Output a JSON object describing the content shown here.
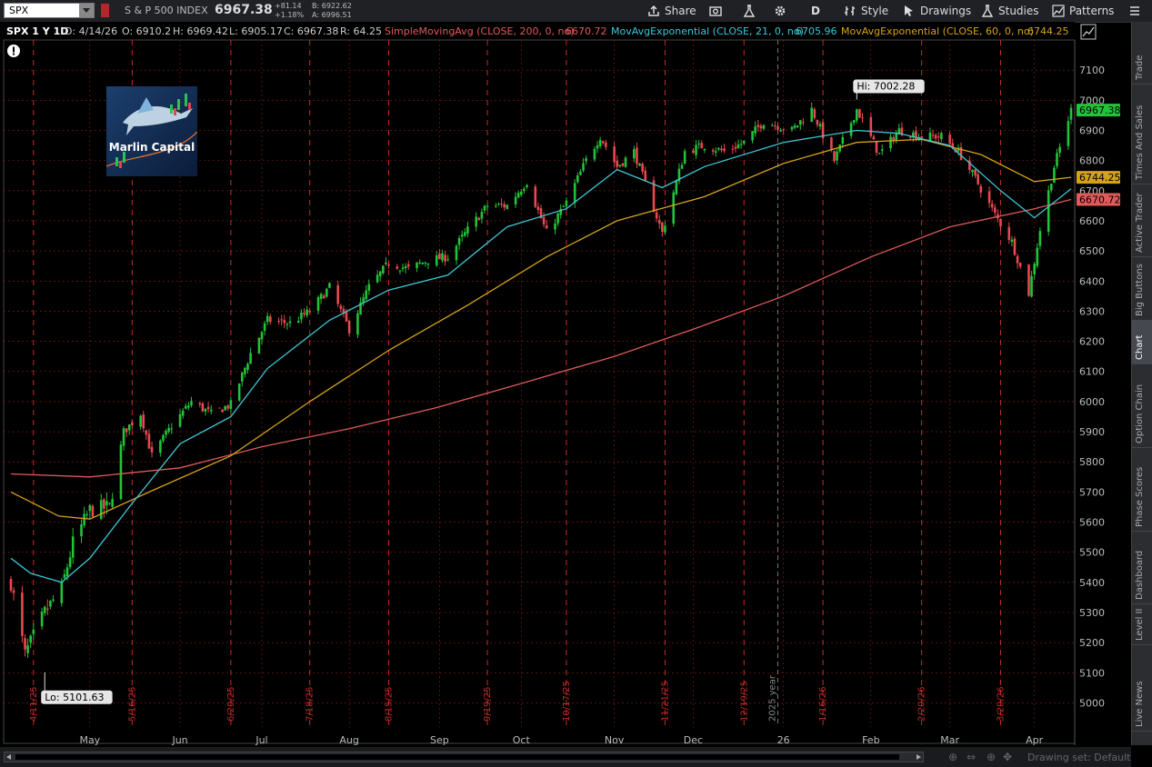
{
  "toolbar": {
    "symbol": "SPX",
    "index_name": "S & P 500 INDEX",
    "last_price": "6967.38",
    "change": "+81.14",
    "change_pct": "+1.18%",
    "bid": "B: 6922.62",
    "ask": "A: 6996.51",
    "buttons": {
      "share": "Share",
      "aggregation": "D",
      "style": "Style",
      "drawings": "Drawings",
      "studies": "Studies",
      "patterns": "Patterns"
    }
  },
  "study_bar": {
    "title": "SPX 1 Y 1D",
    "date": "D: 4/14/26",
    "open": "O: 6910.2",
    "high": "H: 6969.42",
    "low": "L: 6905.17",
    "close": "C: 6967.38",
    "range": "R: 64.25",
    "sma200_label": "SimpleMovingAvg (CLOSE, 200, 0, no)",
    "sma200_value": "6670.72",
    "ema21_label": "MovAvgExponential (CLOSE, 21, 0, no)",
    "ema21_value": "6705.96",
    "ema60_label": "MovAvgExponential (CLOSE, 60, 0, no)",
    "ema60_value": "6744.25"
  },
  "logo": {
    "text": "Marlin Capital"
  },
  "sidebar": [
    "Trade",
    "Times And Sales",
    "Active Trader",
    "Big Buttons",
    "Chart",
    "Option Chain",
    "Phase Scores",
    "Dashboard",
    "Level II",
    "Live News"
  ],
  "bottom": {
    "drawing_set": "Drawing set: Default"
  },
  "colors": {
    "up": "#22c33a",
    "down": "#e8484f",
    "ema21": "#3ec6d6",
    "ema60": "#d4a21a",
    "sma200": "#e05a5a",
    "grid": "#8b1a1a",
    "background": "#000000"
  },
  "chart_data": {
    "type": "candlestick",
    "ylim": [
      4920,
      7200
    ],
    "y_ticks": [
      5000,
      5100,
      5200,
      5300,
      5400,
      5500,
      5600,
      5700,
      5800,
      5900,
      6000,
      6100,
      6200,
      6300,
      6400,
      6500,
      6600,
      6700,
      6800,
      6900,
      7000,
      7100
    ],
    "months": [
      {
        "label": "May",
        "date": "2025-05-01"
      },
      {
        "label": "Jun",
        "date": "2025-06-02"
      },
      {
        "label": "Jul",
        "date": "2025-07-01"
      },
      {
        "label": "Aug",
        "date": "2025-08-01"
      },
      {
        "label": "Sep",
        "date": "2025-09-02"
      },
      {
        "label": "Oct",
        "date": "2025-10-01"
      },
      {
        "label": "Nov",
        "date": "2025-11-03"
      },
      {
        "label": "Dec",
        "date": "2025-12-01"
      },
      {
        "label": "26",
        "date": "2026-01-02"
      },
      {
        "label": "Feb",
        "date": "2026-02-02"
      },
      {
        "label": "Mar",
        "date": "2026-03-02"
      },
      {
        "label": "Apr",
        "date": "2026-04-01"
      }
    ],
    "events": [
      {
        "label": "4/11/25",
        "date": "2025-04-11"
      },
      {
        "label": "5/16/25",
        "date": "2025-05-16"
      },
      {
        "label": "6/20/25",
        "date": "2025-06-20"
      },
      {
        "label": "7/18/25",
        "date": "2025-07-18"
      },
      {
        "label": "8/15/25",
        "date": "2025-08-15"
      },
      {
        "label": "9/19/25",
        "date": "2025-09-19"
      },
      {
        "label": "10/17/25",
        "date": "2025-10-17"
      },
      {
        "label": "11/21/25",
        "date": "2025-11-21"
      },
      {
        "label": "12/19/25",
        "date": "2025-12-19"
      },
      {
        "label": "1/16/26",
        "date": "2026-01-16"
      },
      {
        "label": "2/20/26",
        "date": "2026-02-20"
      },
      {
        "label": "3/20/26",
        "date": "2026-03-20"
      }
    ],
    "year_marker": {
      "label": "2025 year",
      "date": "2025-12-31"
    },
    "hi_label": {
      "text": "Hi: 7002.28",
      "date": "2026-01-28",
      "value": 7002.28
    },
    "lo_label": {
      "text": "Lo: 5101.63",
      "date": "2025-04-15",
      "value": 5101.63
    },
    "price_tags": [
      {
        "value": 6967.38,
        "text": "6967.38",
        "color": "#22c33a"
      },
      {
        "value": 6744.25,
        "text": "6744.25",
        "color": "#d4a21a"
      },
      {
        "value": 6670.72,
        "text": "6670.72",
        "color": "#e05a5a"
      }
    ],
    "range_start": "2025-04-03",
    "range_end": "2026-04-14",
    "anchors": [
      [
        "2025-04-03",
        5400
      ],
      [
        "2025-04-08",
        5160
      ],
      [
        "2025-04-15",
        5300
      ],
      [
        "2025-04-21",
        5380
      ],
      [
        "2025-04-25",
        5530
      ],
      [
        "2025-05-01",
        5640
      ],
      [
        "2025-05-08",
        5650
      ],
      [
        "2025-05-13",
        5900
      ],
      [
        "2025-05-19",
        5960
      ],
      [
        "2025-05-23",
        5820
      ],
      [
        "2025-05-30",
        5920
      ],
      [
        "2025-06-06",
        6000
      ],
      [
        "2025-06-13",
        5960
      ],
      [
        "2025-06-20",
        5990
      ],
      [
        "2025-06-27",
        6160
      ],
      [
        "2025-07-03",
        6270
      ],
      [
        "2025-07-11",
        6260
      ],
      [
        "2025-07-18",
        6300
      ],
      [
        "2025-07-25",
        6380
      ],
      [
        "2025-08-01",
        6240
      ],
      [
        "2025-08-08",
        6380
      ],
      [
        "2025-08-15",
        6460
      ],
      [
        "2025-08-22",
        6440
      ],
      [
        "2025-08-29",
        6470
      ],
      [
        "2025-09-05",
        6480
      ],
      [
        "2025-09-12",
        6570
      ],
      [
        "2025-09-19",
        6650
      ],
      [
        "2025-09-26",
        6650
      ],
      [
        "2025-10-03",
        6730
      ],
      [
        "2025-10-10",
        6560
      ],
      [
        "2025-10-17",
        6660
      ],
      [
        "2025-10-24",
        6800
      ],
      [
        "2025-10-29",
        6880
      ],
      [
        "2025-11-04",
        6780
      ],
      [
        "2025-11-10",
        6830
      ],
      [
        "2025-11-20",
        6560
      ],
      [
        "2025-11-28",
        6830
      ],
      [
        "2025-12-05",
        6850
      ],
      [
        "2025-12-12",
        6830
      ],
      [
        "2025-12-19",
        6860
      ],
      [
        "2025-12-26",
        6930
      ],
      [
        "2026-01-05",
        6900
      ],
      [
        "2026-01-12",
        6970
      ],
      [
        "2026-01-20",
        6800
      ],
      [
        "2026-01-28",
        6970
      ],
      [
        "2026-02-05",
        6820
      ],
      [
        "2026-02-12",
        6900
      ],
      [
        "2026-02-20",
        6880
      ],
      [
        "2026-02-27",
        6880
      ],
      [
        "2026-03-05",
        6830
      ],
      [
        "2026-03-11",
        6740
      ],
      [
        "2026-03-18",
        6620
      ],
      [
        "2026-03-24",
        6530
      ],
      [
        "2026-03-30",
        6360
      ],
      [
        "2026-04-03",
        6570
      ],
      [
        "2026-04-08",
        6780
      ],
      [
        "2026-04-14",
        6967.38
      ]
    ],
    "ema21_points": [
      [
        "2025-04-03",
        5480
      ],
      [
        "2025-04-10",
        5430
      ],
      [
        "2025-04-21",
        5400
      ],
      [
        "2025-05-01",
        5480
      ],
      [
        "2025-05-15",
        5650
      ],
      [
        "2025-06-02",
        5860
      ],
      [
        "2025-06-20",
        5950
      ],
      [
        "2025-07-03",
        6110
      ],
      [
        "2025-07-25",
        6270
      ],
      [
        "2025-08-15",
        6370
      ],
      [
        "2025-09-05",
        6420
      ],
      [
        "2025-09-26",
        6580
      ],
      [
        "2025-10-17",
        6640
      ],
      [
        "2025-11-04",
        6770
      ],
      [
        "2025-11-20",
        6710
      ],
      [
        "2025-12-05",
        6780
      ],
      [
        "2026-01-02",
        6860
      ],
      [
        "2026-01-28",
        6900
      ],
      [
        "2026-02-12",
        6890
      ],
      [
        "2026-03-02",
        6850
      ],
      [
        "2026-03-20",
        6700
      ],
      [
        "2026-04-01",
        6610
      ],
      [
        "2026-04-14",
        6705.96
      ]
    ],
    "ema60_points": [
      [
        "2025-04-03",
        5700
      ],
      [
        "2025-04-20",
        5620
      ],
      [
        "2025-05-01",
        5610
      ],
      [
        "2025-05-22",
        5700
      ],
      [
        "2025-06-20",
        5820
      ],
      [
        "2025-07-18",
        6000
      ],
      [
        "2025-08-15",
        6170
      ],
      [
        "2025-09-12",
        6320
      ],
      [
        "2025-10-10",
        6480
      ],
      [
        "2025-11-04",
        6600
      ],
      [
        "2025-12-05",
        6680
      ],
      [
        "2026-01-02",
        6790
      ],
      [
        "2026-01-28",
        6860
      ],
      [
        "2026-02-20",
        6870
      ],
      [
        "2026-03-13",
        6820
      ],
      [
        "2026-04-01",
        6730
      ],
      [
        "2026-04-14",
        6744.25
      ]
    ],
    "sma200_points": [
      [
        "2025-04-03",
        5760
      ],
      [
        "2025-05-01",
        5750
      ],
      [
        "2025-06-02",
        5780
      ],
      [
        "2025-07-01",
        5850
      ],
      [
        "2025-08-01",
        5910
      ],
      [
        "2025-09-01",
        5980
      ],
      [
        "2025-10-01",
        6060
      ],
      [
        "2025-11-03",
        6150
      ],
      [
        "2025-12-01",
        6240
      ],
      [
        "2026-01-02",
        6350
      ],
      [
        "2026-02-02",
        6480
      ],
      [
        "2026-03-02",
        6580
      ],
      [
        "2026-04-01",
        6640
      ],
      [
        "2026-04-14",
        6670.72
      ]
    ]
  }
}
